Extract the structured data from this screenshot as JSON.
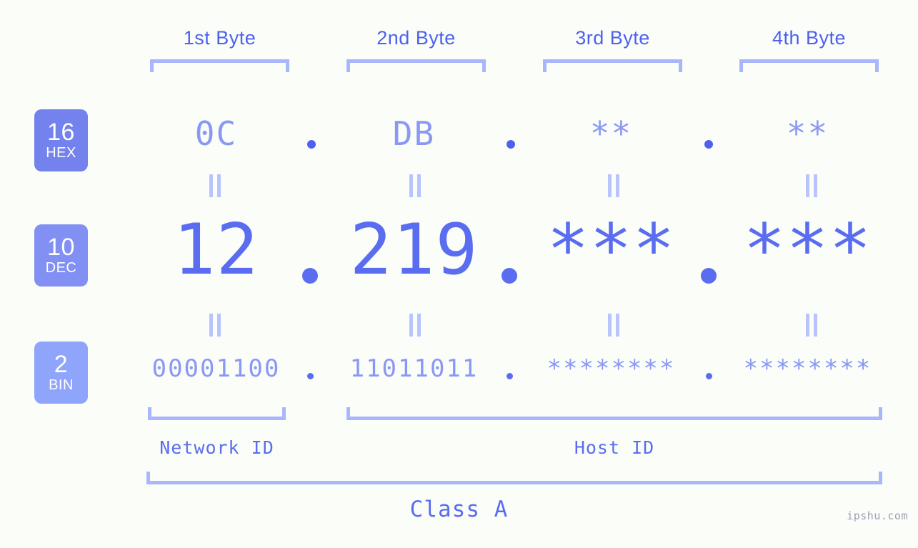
{
  "meta": {
    "background": "#fbfdf8",
    "accent_strong": "#4d61ee",
    "accent_mid": "#5a6df0",
    "accent_soft": "#8a98f5",
    "accent_light": "#aab6fb",
    "watermark": "ipshu.com"
  },
  "headers": [
    {
      "label": "1st Byte"
    },
    {
      "label": "2nd Byte"
    },
    {
      "label": "3rd Byte"
    },
    {
      "label": "4th Byte"
    }
  ],
  "bases": [
    {
      "number": "16",
      "system": "HEX",
      "color": "#7382ec"
    },
    {
      "number": "10",
      "system": "DEC",
      "color": "#8290f3"
    },
    {
      "number": "2",
      "system": "BIN",
      "color": "#8fa4fb"
    }
  ],
  "rows": {
    "hex": {
      "base_number": "16",
      "base_system": "HEX",
      "values": [
        "0C",
        "DB",
        "**",
        "**"
      ],
      "separator": "."
    },
    "dec": {
      "base_number": "10",
      "base_system": "DEC",
      "values": [
        "12",
        "219",
        "***",
        "***"
      ],
      "separator": "."
    },
    "bin": {
      "base_number": "2",
      "base_system": "BIN",
      "values": [
        "00001100",
        "11011011",
        "********",
        "********"
      ],
      "separator": "."
    }
  },
  "connectors": {
    "symbol": "="
  },
  "sections": {
    "network_id": "Network ID",
    "host_id": "Host ID",
    "class": "Class A"
  }
}
